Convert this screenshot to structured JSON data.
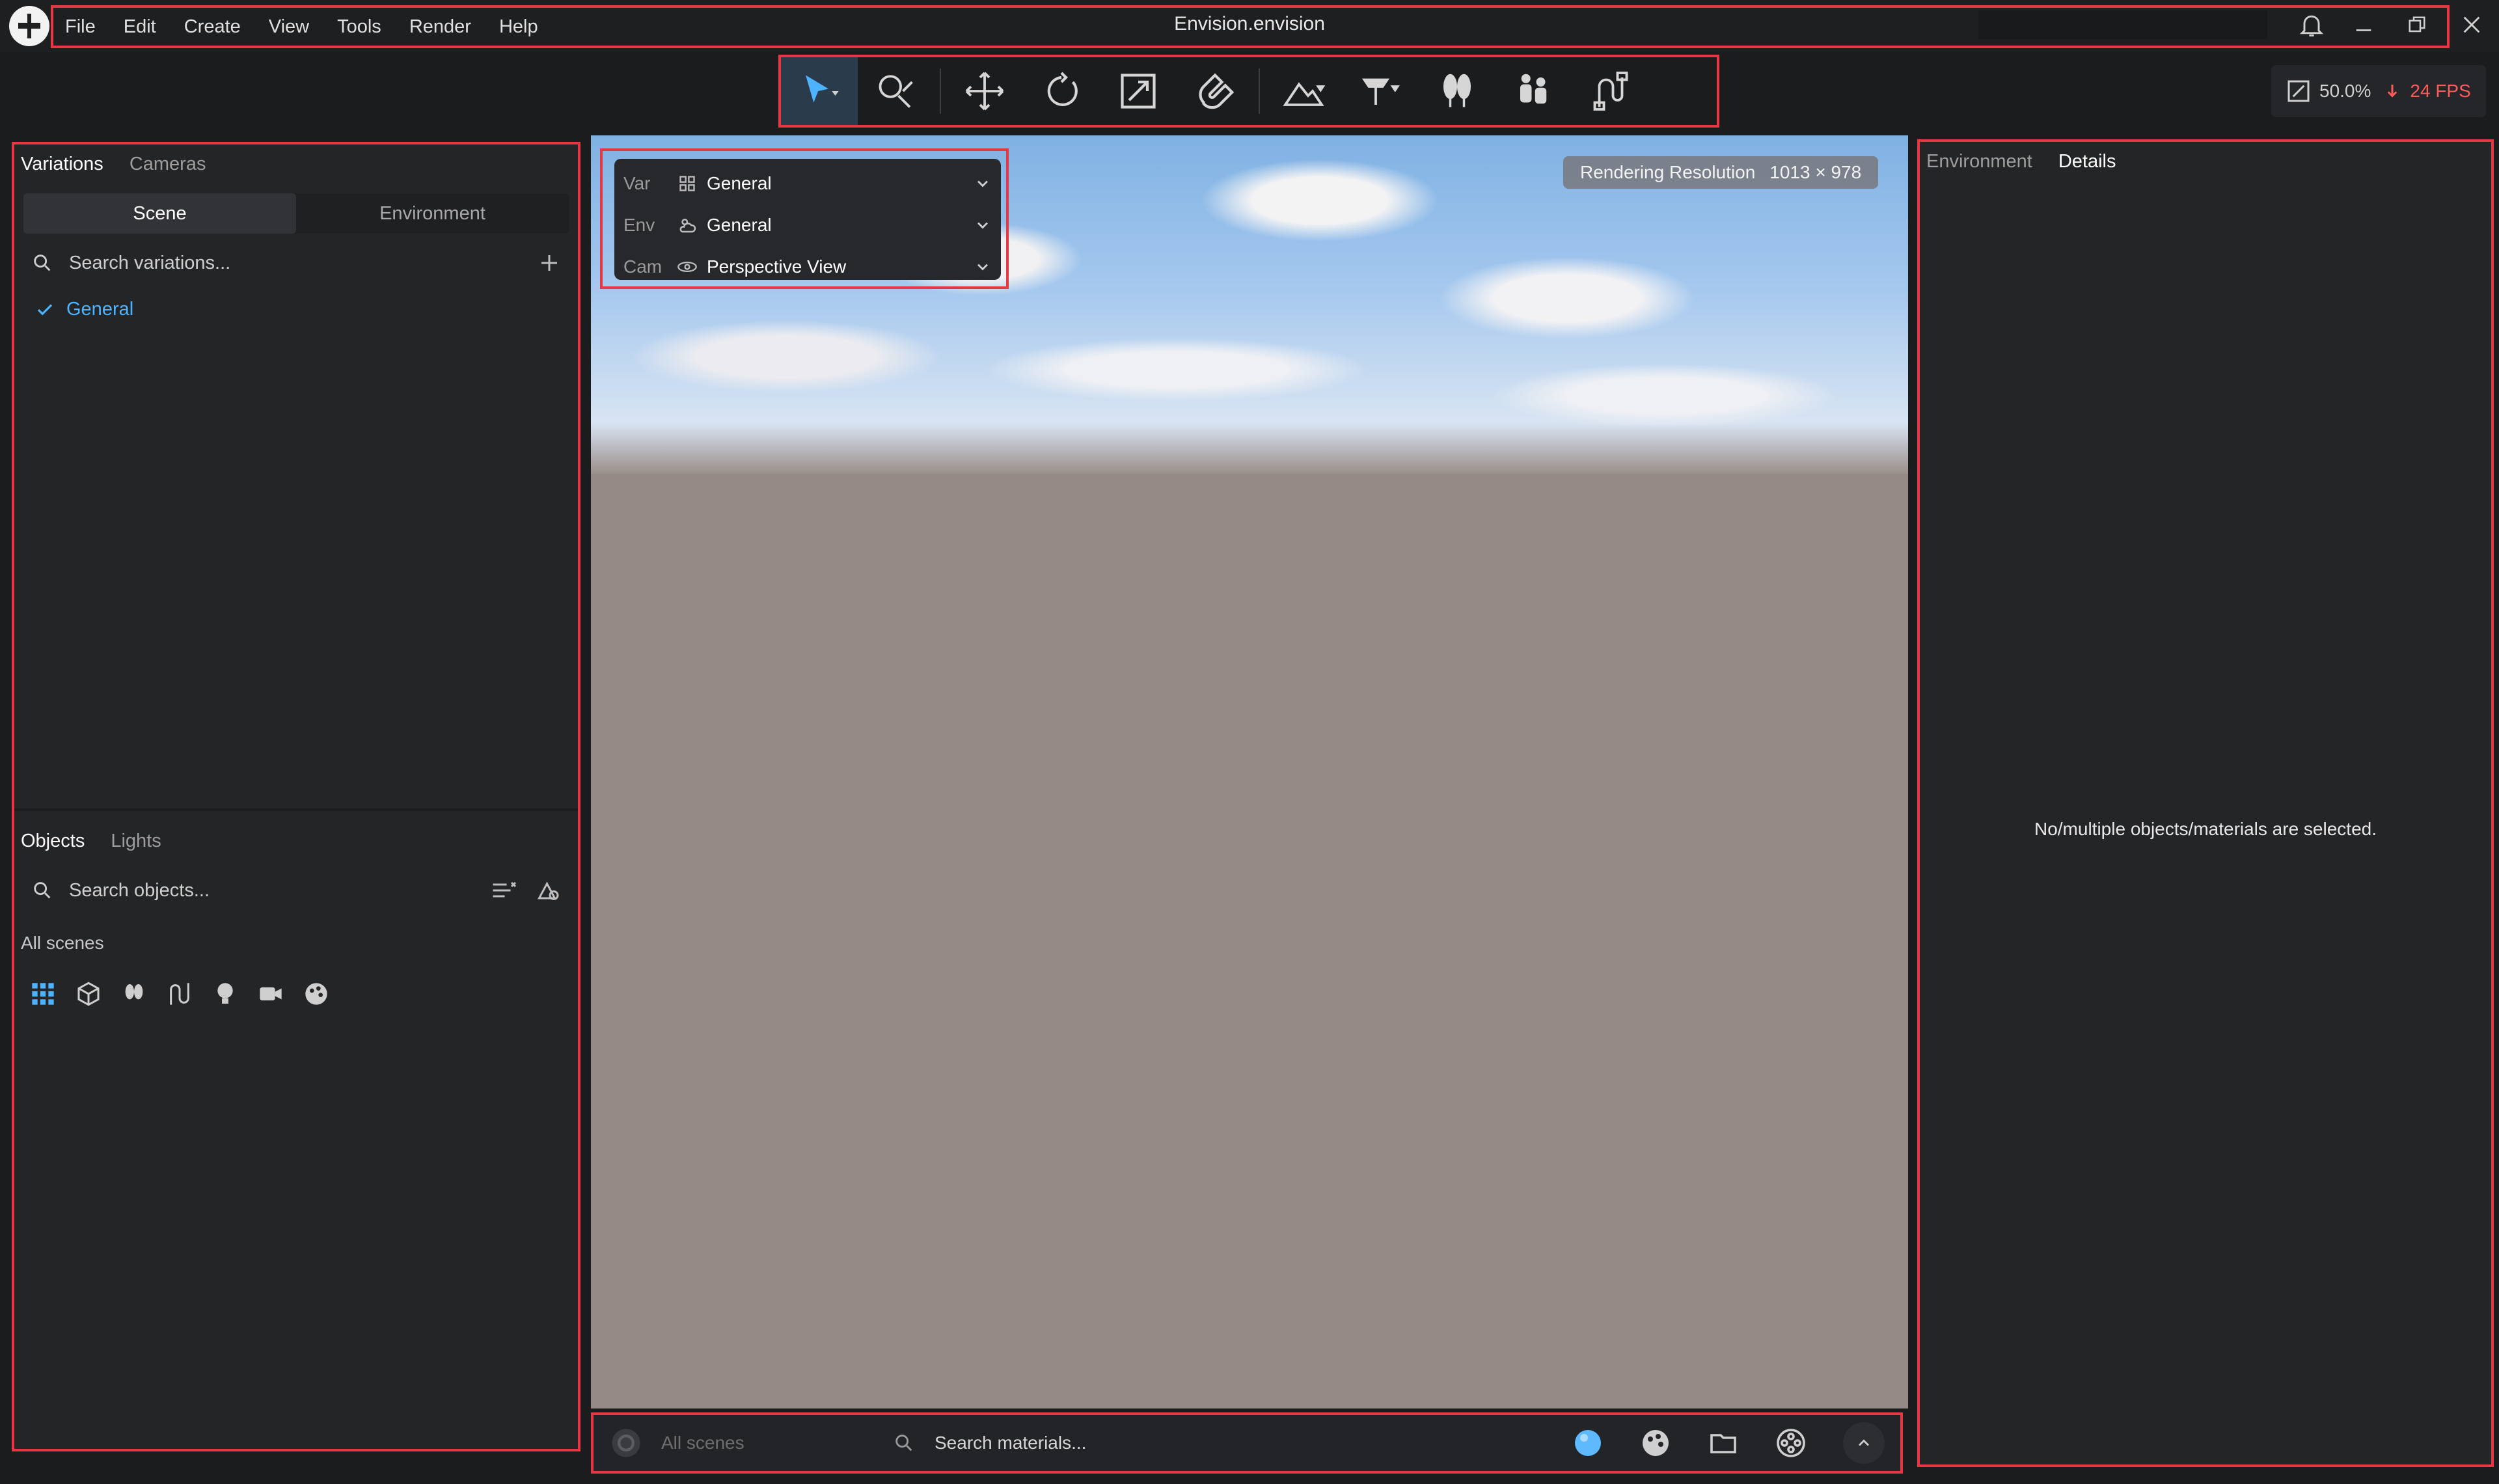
{
  "menu": [
    "File",
    "Edit",
    "Create",
    "View",
    "Tools",
    "Render",
    "Help"
  ],
  "title": "Envision.envision",
  "stats": {
    "zoom": "50.0%",
    "fps": "24 FPS"
  },
  "left": {
    "tabs": [
      "Variations",
      "Cameras"
    ],
    "segment": [
      "Scene",
      "Environment"
    ],
    "variations_search_placeholder": "Search variations...",
    "variations": [
      {
        "label": "General",
        "checked": true
      }
    ],
    "objects_tabs": [
      "Objects",
      "Lights"
    ],
    "objects_search_placeholder": "Search objects...",
    "scope_label": "All scenes"
  },
  "viewport": {
    "rendering_resolution_label": "Rendering Resolution",
    "rendering_resolution_value": "1013 × 978",
    "overlay": [
      {
        "label": "Var",
        "icon": "grid-icon",
        "value": "General"
      },
      {
        "label": "Env",
        "icon": "weather-icon",
        "value": "General"
      },
      {
        "label": "Cam",
        "icon": "camera-view-icon",
        "value": "Perspective View"
      }
    ]
  },
  "bottom": {
    "scope_label": "All scenes",
    "search_placeholder": "Search materials..."
  },
  "right": {
    "tabs": [
      "Environment",
      "Details"
    ],
    "empty_message": "No/multiple objects/materials are selected."
  },
  "colors": {
    "accent": "#4db3ff",
    "highlight": "#e53842"
  }
}
